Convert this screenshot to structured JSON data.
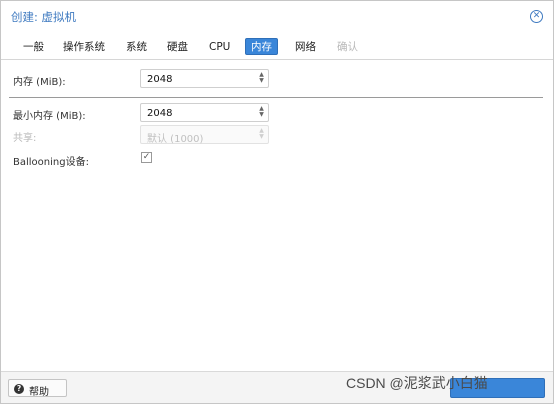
{
  "window": {
    "title": "创建: 虚拟机"
  },
  "tabs": [
    {
      "label": "一般",
      "state": "normal"
    },
    {
      "label": "操作系统",
      "state": "normal"
    },
    {
      "label": "系统",
      "state": "normal"
    },
    {
      "label": "硬盘",
      "state": "normal"
    },
    {
      "label": "CPU",
      "state": "normal"
    },
    {
      "label": "内存",
      "state": "active"
    },
    {
      "label": "网络",
      "state": "normal"
    },
    {
      "label": "确认",
      "state": "disabled"
    }
  ],
  "form": {
    "memory": {
      "label": "内存 (MiB):",
      "value": "2048"
    },
    "min_memory": {
      "label": "最小内存 (MiB):",
      "value": "2048"
    },
    "shares": {
      "label": "共享:",
      "value": "默认 (1000)"
    },
    "ballooning": {
      "label": "Ballooning设备:",
      "checked": true
    }
  },
  "footer": {
    "help_label": "帮助"
  },
  "watermark": "CSDN @泥浆武小白猫",
  "colors": {
    "accent": "#3a86d9",
    "title": "#3f7ac0"
  }
}
